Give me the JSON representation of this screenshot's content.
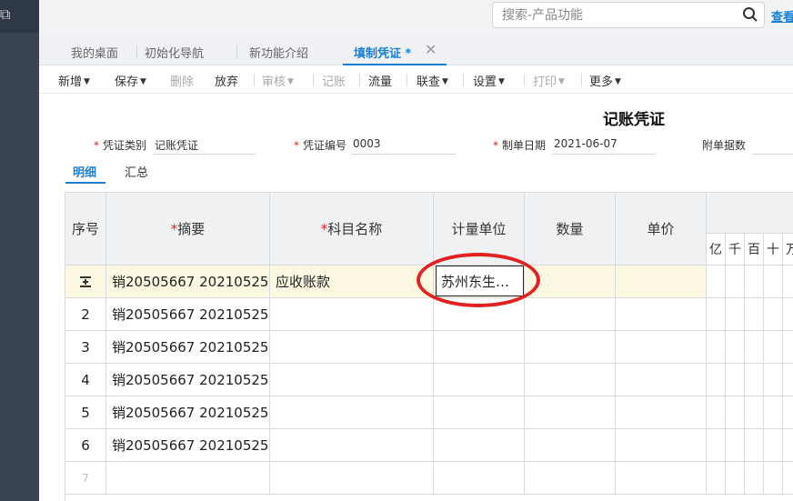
{
  "search": {
    "placeholder": "搜索-产品功能",
    "view_label": "查看"
  },
  "tabs": [
    {
      "label": "我的桌面"
    },
    {
      "label": "初始化导航"
    },
    {
      "label": "新功能介绍"
    },
    {
      "label": "填制凭证 *",
      "active": true
    }
  ],
  "toolbar": {
    "add": "新增",
    "save": "保存",
    "delete": "删除",
    "discard": "放弃",
    "review": "审核",
    "post": "记账",
    "flow": "流量",
    "query": "联查",
    "settings": "设置",
    "print": "打印",
    "more": "更多"
  },
  "voucher": {
    "title": "记账凭证",
    "type_label": "凭证类别",
    "type_value": "记账凭证",
    "number_label": "凭证编号",
    "number_value": "0003",
    "date_label": "制单日期",
    "date_value": "2021-06-07",
    "attach_label": "附单据数"
  },
  "subtabs": {
    "detail": "明细",
    "summary": "汇总"
  },
  "grid": {
    "headers": {
      "seq": "序号",
      "summary": "摘要",
      "account": "科目名称",
      "unit": "计量单位",
      "qty": "数量",
      "price": "单价"
    },
    "digits": [
      "亿",
      "千",
      "百",
      "十",
      "万"
    ],
    "rows": [
      {
        "seq": "",
        "summary": "销20505667 20210525",
        "account": "应收账款"
      },
      {
        "seq": "2",
        "summary": "销20505667 20210525",
        "account": ""
      },
      {
        "seq": "3",
        "summary": "销20505667 20210525",
        "account": ""
      },
      {
        "seq": "4",
        "summary": "销20505667 20210525",
        "account": ""
      },
      {
        "seq": "5",
        "summary": "销20505667 20210525",
        "account": ""
      },
      {
        "seq": "6",
        "summary": "销20505667 20210525",
        "account": ""
      },
      {
        "seq": "7",
        "summary": "",
        "account": ""
      }
    ],
    "editor_value": "苏州东生…"
  },
  "colors": {
    "accent": "#1a7fd6",
    "required": "#e02020",
    "highlight_ring": "#e22222",
    "selected_row": "#fdf8e1"
  }
}
